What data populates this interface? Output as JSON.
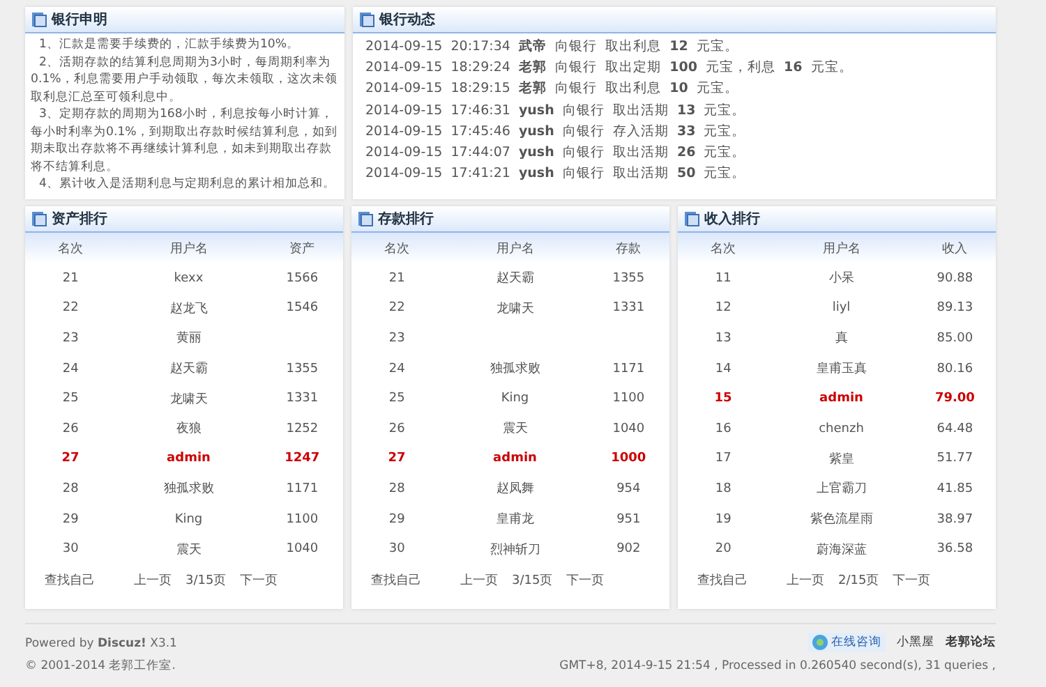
{
  "notice": {
    "title": "银行申明",
    "paragraphs": [
      "1、汇款是需要手续费的，汇款手续费为10%。",
      "2、活期存款的结算利息周期为3小时，每周期利率为0.1%，利息需要用户手动领取，每次未领取，这次未领取利息汇总至可领利息中。",
      "3、定期存款的周期为168小时，利息按每小时计算，每小时利率为0.1%，到期取出存款时候结算利息，如到期未取出存款将不再继续计算利息，如未到期取出存款将不结算利息。",
      "4、累计收入是活期利息与定期利息的累计相加总和。"
    ]
  },
  "activity": {
    "title": "银行动态",
    "entries": [
      "2014-09-15  20:17:34  **武帝**  向银行  取出利息  **12**  元宝。",
      "2014-09-15  18:29:24  **老郭**  向银行  取出定期  **100**  元宝，利息  **16**  元宝。",
      "2014-09-15  18:29:15  **老郭**  向银行  取出利息  **10**  元宝。",
      "2014-09-15  17:46:31  **yush**  向银行  取出活期  **13**  元宝。",
      "2014-09-15  17:45:46  **yush**  向银行  存入活期  **33**  元宝。",
      "2014-09-15  17:44:07  **yush**  向银行  取出活期  **26**  元宝。",
      "2014-09-15  17:41:21  **yush**  向银行  取出活期  **50**  元宝。"
    ]
  },
  "rankings": [
    {
      "title": "资产排行",
      "columns": [
        "名次",
        "用户名",
        "资产"
      ],
      "rows": [
        {
          "rank": "21",
          "user": "kexx",
          "value": "1566",
          "current_user": false
        },
        {
          "rank": "22",
          "user": "赵龙飞",
          "value": "1546",
          "current_user": false
        },
        {
          "rank": "23",
          "user": "黄丽",
          "current_user": false
        },
        {
          "rank": "24",
          "user": "赵天霸",
          "value": "1355",
          "current_user": false
        },
        {
          "rank": "25",
          "user": "龙啸天",
          "value": "1331",
          "current_user": false
        },
        {
          "rank": "26",
          "user": "夜狼",
          "value": "1252",
          "current_user": false
        },
        {
          "rank": "27",
          "user": "admin",
          "value": "1247",
          "current_user": true
        },
        {
          "rank": "28",
          "user": "独孤求败",
          "value": "1171",
          "current_user": false
        },
        {
          "rank": "29",
          "user": "King",
          "value": "1100",
          "current_user": false
        },
        {
          "rank": "30",
          "user": "震天",
          "value": "1040",
          "current_user": false
        }
      ],
      "find_self": "查找自己",
      "prev": "上一页",
      "page": "3/15页",
      "next": "下一页"
    },
    {
      "title": "存款排行",
      "columns": [
        "名次",
        "用户名",
        "存款"
      ],
      "rows": [
        {
          "rank": "21",
          "user": "赵天霸",
          "value": "1355",
          "current_user": false
        },
        {
          "rank": "22",
          "user": "龙啸天",
          "value": "1331",
          "current_user": false
        },
        {
          "rank": "23",
          "current_user": false
        },
        {
          "rank": "24",
          "user": "独孤求败",
          "value": "1171",
          "current_user": false
        },
        {
          "rank": "25",
          "user": "King",
          "value": "1100",
          "current_user": false
        },
        {
          "rank": "26",
          "user": "震天",
          "value": "1040",
          "current_user": false
        },
        {
          "rank": "27",
          "user": "admin",
          "value": "1000",
          "current_user": true
        },
        {
          "rank": "28",
          "user": "赵凤舞",
          "value": "954",
          "current_user": false
        },
        {
          "rank": "29",
          "user": "皇甫龙",
          "value": "951",
          "current_user": false
        },
        {
          "rank": "30",
          "user": "烈神斩刀",
          "value": "902",
          "current_user": false
        }
      ],
      "find_self": "查找自己",
      "prev": "上一页",
      "page": "3/15页",
      "next": "下一页"
    },
    {
      "title": "收入排行",
      "columns": [
        "名次",
        "用户名",
        "收入"
      ],
      "rows": [
        {
          "rank": "11",
          "user": "小呆",
          "value": "90.88",
          "current_user": false
        },
        {
          "rank": "12",
          "user": "liyl",
          "value": "89.13",
          "current_user": false
        },
        {
          "rank": "13",
          "user": "真",
          "value": "85.00",
          "current_user": false
        },
        {
          "rank": "14",
          "user": "皇甫玉真",
          "value": "80.16",
          "current_user": false
        },
        {
          "rank": "15",
          "user": "admin",
          "value": "79.00",
          "current_user": true
        },
        {
          "rank": "16",
          "user": "chenzh",
          "value": "64.48",
          "current_user": false
        },
        {
          "rank": "17",
          "user": "紫皇",
          "value": "51.77",
          "current_user": false
        },
        {
          "rank": "18",
          "user": "上官霸刀",
          "value": "41.85",
          "current_user": false
        },
        {
          "rank": "19",
          "user": "紫色流星雨",
          "value": "38.97",
          "current_user": false
        },
        {
          "rank": "20",
          "user": "蔚海深蓝",
          "value": "36.58",
          "current_user": false
        }
      ],
      "find_self": "查找自己",
      "prev": "上一页",
      "page": "2/15页",
      "next": "下一页"
    }
  ],
  "footer": {
    "powered": "Powered by **Discuz!** X3.1",
    "copyright": "© 2001-2014 老郭工作室.",
    "links": [
      {
        "text": "在线咨询",
        "kind": "chat"
      },
      {
        "text": "小黑屋",
        "kind": "plain"
      },
      {
        "text": "老郭论坛",
        "kind": "bold"
      }
    ],
    "stats": "GMT+8, 2014-9-15 21:54 , Processed in 0.260540 second(s), 31 queries ,"
  }
}
